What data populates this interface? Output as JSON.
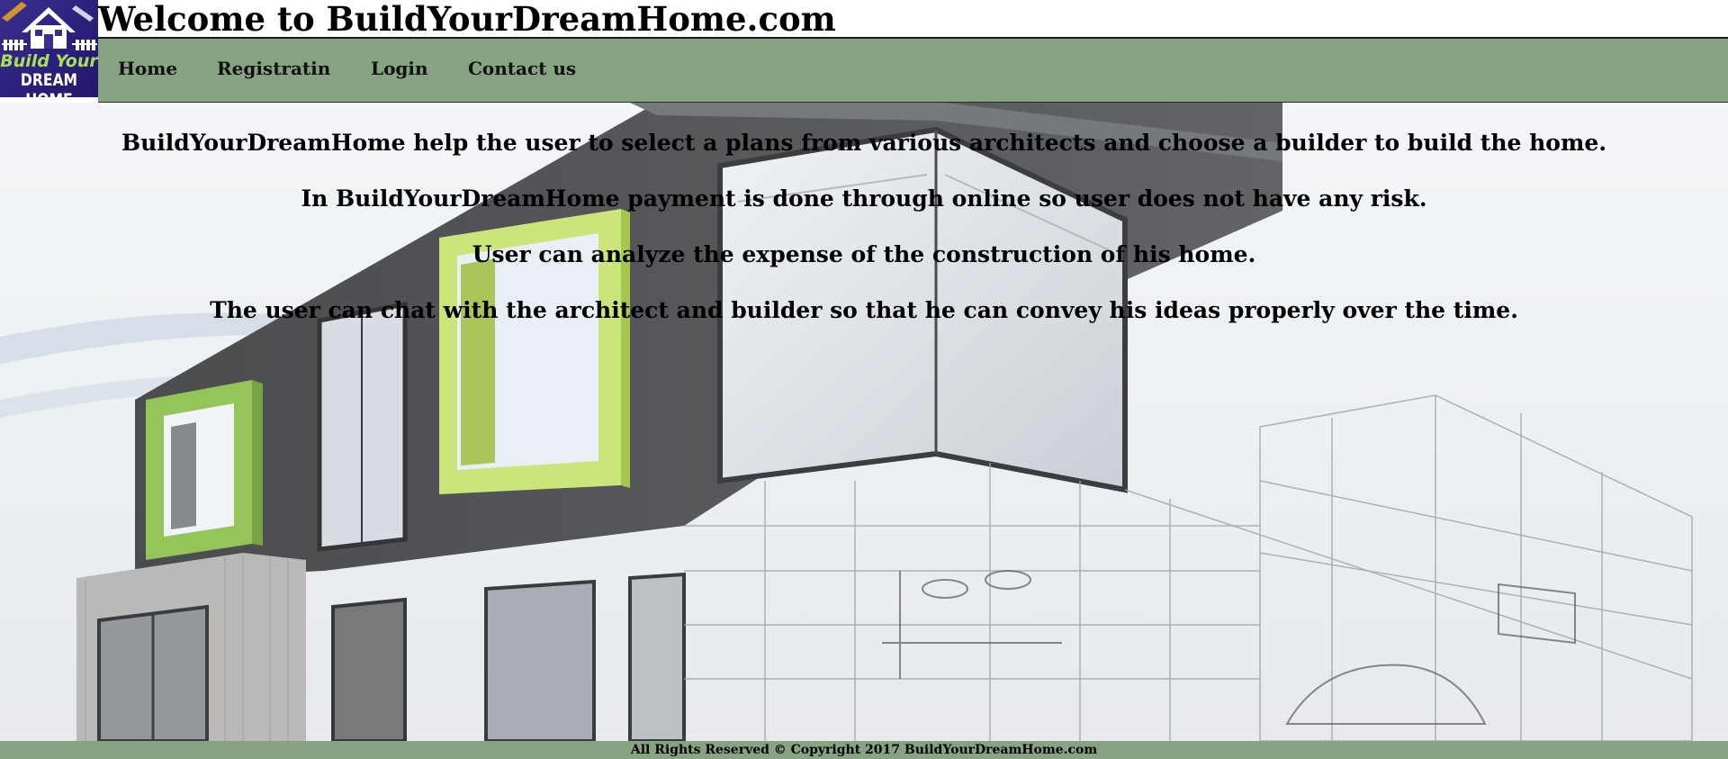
{
  "logo": {
    "line1": "Build Your",
    "line2": "DREAM HOME"
  },
  "header": {
    "title": "Welcome to BuildYourDreamHome.com"
  },
  "nav": {
    "items": [
      {
        "label": "Home"
      },
      {
        "label": "Registratin"
      },
      {
        "label": "Login"
      },
      {
        "label": "Contact us"
      }
    ]
  },
  "main": {
    "lines": [
      "BuildYourDreamHome help the user to select a plans from various architects and choose a builder to build the home.",
      "In BuildYourDreamHome payment is done through online so user does not have any risk.",
      "User can analyze the expense of the construction of his home.",
      "The user can chat with the architect and builder so that he can convey his ideas properly over the time."
    ]
  },
  "footer": {
    "text": "All Rights Reserved © Copyright 2017 BuildYourDreamHome.com"
  },
  "colors": {
    "nav_bg": "#86a382",
    "logo_bg": "#2a1f7a",
    "accent_green": "#a8d44a"
  }
}
